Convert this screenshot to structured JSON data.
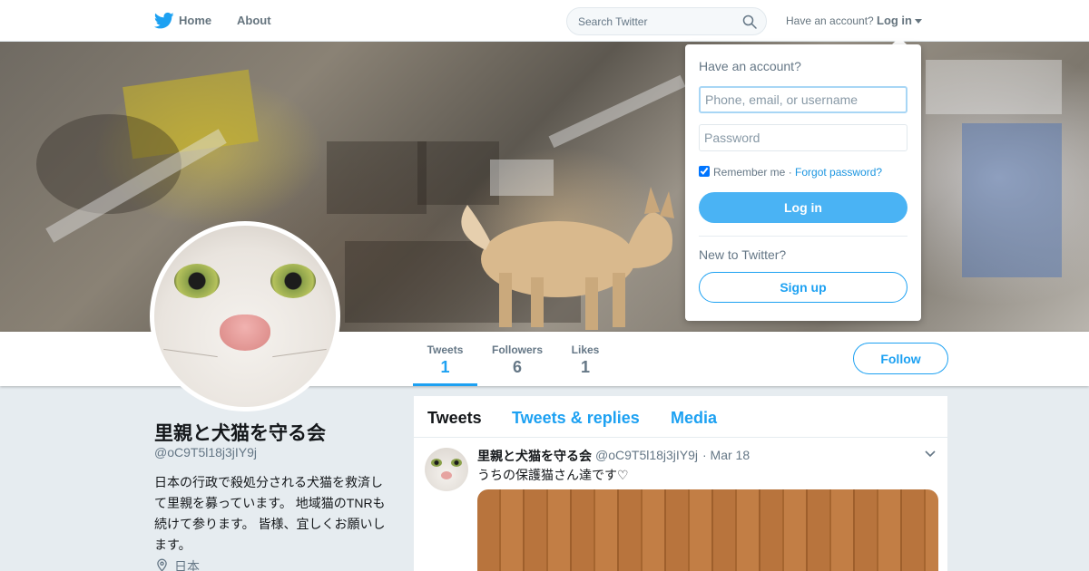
{
  "nav": {
    "logo_icon": "twitter-bird-icon",
    "home_label": "Home",
    "about_label": "About",
    "search_placeholder": "Search Twitter",
    "search_icon": "search-icon",
    "have_account_text": "Have an account?",
    "login_label": "Log in",
    "brand_color": "#1da1f2"
  },
  "login_dropdown": {
    "title": "Have an account?",
    "username_placeholder": "Phone, email, or username",
    "password_placeholder": "Password",
    "remember_label": "Remember me",
    "separator": " · ",
    "forgot_label": "Forgot password?",
    "login_button": "Log in",
    "new_text": "New to Twitter?",
    "signup_button": "Sign up"
  },
  "profile_nav": {
    "stats": [
      {
        "label": "Tweets",
        "value": "1"
      },
      {
        "label": "Followers",
        "value": "6"
      },
      {
        "label": "Likes",
        "value": "1"
      }
    ],
    "follow_button": "Follow"
  },
  "profile": {
    "name": "里親と犬猫を守る会",
    "handle": "@oC9T5l18j3jIY9j",
    "bio": "日本の行政で殺処分される犬猫を救済して里親を募っています。 地域猫のTNRも続けて参ります。 皆様、宜しくお願いします。",
    "location": "日本",
    "location_icon": "location-pin-icon"
  },
  "timeline": {
    "tabs": [
      {
        "label": "Tweets"
      },
      {
        "label": "Tweets & replies"
      },
      {
        "label": "Media"
      }
    ],
    "tweets": [
      {
        "name": "里親と犬猫を守る会",
        "handle": "@oC9T5l18j3jIY9j",
        "date": "· Mar 18",
        "text": "うちの保護猫さん達です♡",
        "chevron_icon": "chevron-down-icon"
      }
    ]
  }
}
